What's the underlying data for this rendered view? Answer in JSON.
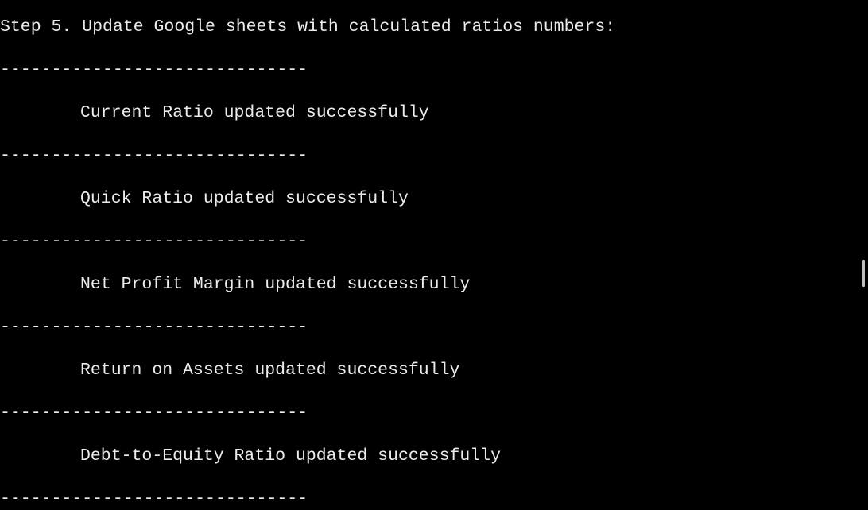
{
  "terminal": {
    "step_heading": "Step 5. Update Google sheets with calculated ratios numbers:",
    "separator": "------------------------------",
    "messages": [
      "Current Ratio updated successfully",
      "Quick Ratio updated successfully",
      "Net Profit Margin updated successfully",
      "Return on Assets updated successfully",
      "Debt-to-Equity Ratio updated successfully"
    ]
  },
  "colors": {
    "background": "#000000",
    "text": "#ececec",
    "scrollbar": "#bdbdbd"
  }
}
